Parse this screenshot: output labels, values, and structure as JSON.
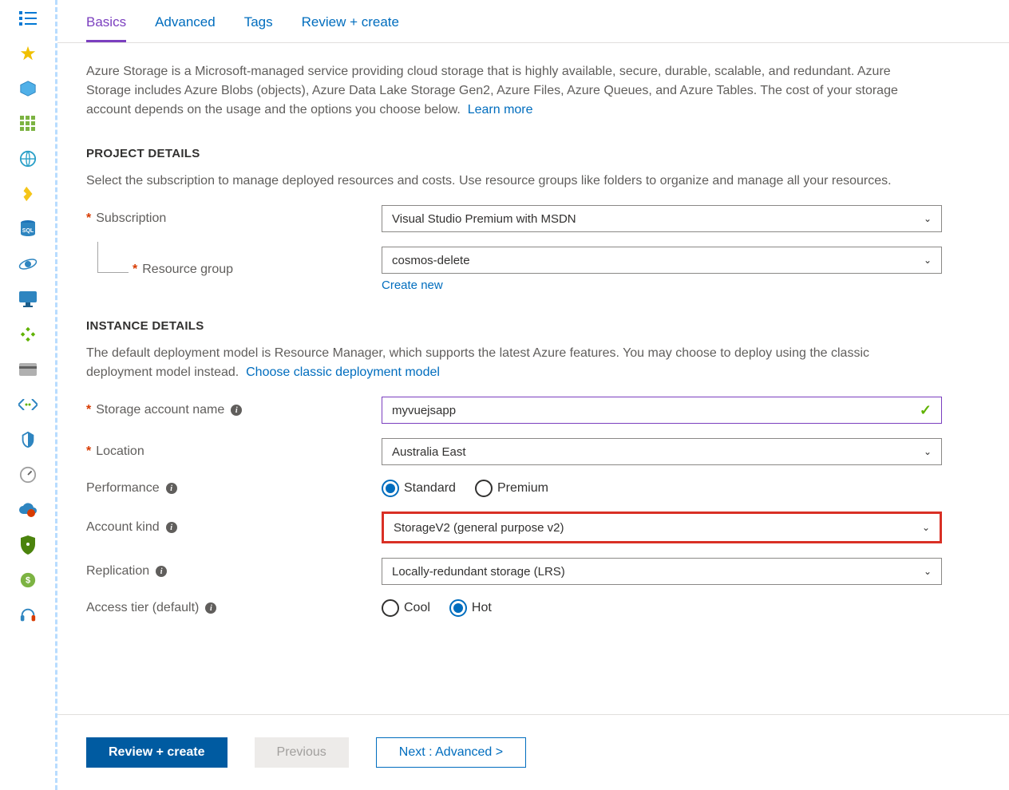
{
  "tabs": {
    "basics": "Basics",
    "advanced": "Advanced",
    "tags": "Tags",
    "review": "Review + create",
    "active": "basics"
  },
  "intro": {
    "text": "Azure Storage is a Microsoft-managed service providing cloud storage that is highly available, secure, durable, scalable, and redundant. Azure Storage includes Azure Blobs (objects), Azure Data Lake Storage Gen2, Azure Files, Azure Queues, and Azure Tables. The cost of your storage account depends on the usage and the options you choose below.",
    "learn_more": "Learn more"
  },
  "project": {
    "section_title": "PROJECT DETAILS",
    "desc": "Select the subscription to manage deployed resources and costs. Use resource groups like folders to organize and manage all your resources.",
    "subscription_label": "Subscription",
    "subscription_value": "Visual Studio Premium with MSDN",
    "rg_label": "Resource group",
    "rg_value": "cosmos-delete",
    "create_new": "Create new"
  },
  "instance": {
    "section_title": "INSTANCE DETAILS",
    "desc": "The default deployment model is Resource Manager, which supports the latest Azure features. You may choose to deploy using the classic deployment model instead.",
    "classic_link": "Choose classic deployment model",
    "name_label": "Storage account name",
    "name_value": "myvuejsapp",
    "location_label": "Location",
    "location_value": "Australia East",
    "perf_label": "Performance",
    "perf_options": {
      "standard": "Standard",
      "premium": "Premium"
    },
    "perf_selected": "standard",
    "kind_label": "Account kind",
    "kind_value": "StorageV2 (general purpose v2)",
    "replication_label": "Replication",
    "replication_value": "Locally-redundant storage (LRS)",
    "tier_label": "Access tier (default)",
    "tier_options": {
      "cool": "Cool",
      "hot": "Hot"
    },
    "tier_selected": "hot"
  },
  "footer": {
    "review": "Review + create",
    "previous": "Previous",
    "next": "Next : Advanced >"
  },
  "sidebar_icons": [
    "list-icon",
    "star-icon",
    "box-icon",
    "grid-icon",
    "globe-icon",
    "function-icon",
    "sql-icon",
    "cosmos-icon",
    "monitor-icon",
    "dev-icon",
    "billing-icon",
    "code-icon",
    "advisor-icon",
    "gauge-icon",
    "cloud-icon",
    "security-icon",
    "cost-icon",
    "support-icon"
  ]
}
